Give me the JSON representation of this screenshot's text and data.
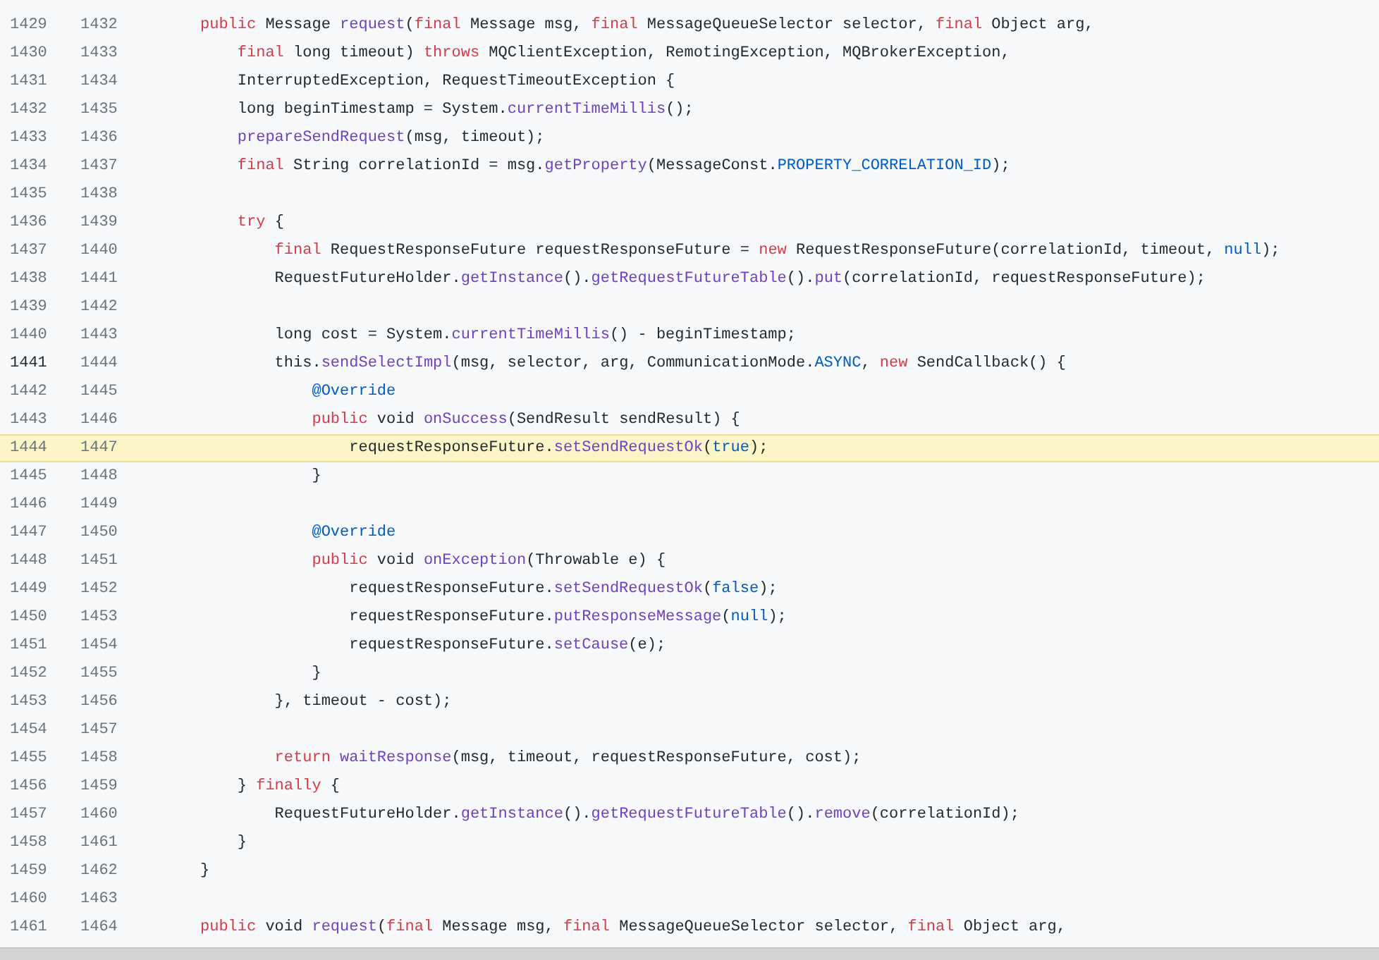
{
  "lines": [
    {
      "old": "1429",
      "new": "1432",
      "code": [
        {
          "kind": "keyword",
          "text": "public"
        },
        {
          "kind": "plain",
          "text": " Message "
        },
        {
          "kind": "function",
          "text": "request"
        },
        {
          "kind": "plain",
          "text": "("
        },
        {
          "kind": "keyword",
          "text": "final"
        },
        {
          "kind": "plain",
          "text": " Message msg, "
        },
        {
          "kind": "keyword",
          "text": "final"
        },
        {
          "kind": "plain",
          "text": " MessageQueueSelector selector, "
        },
        {
          "kind": "keyword",
          "text": "final"
        },
        {
          "kind": "plain",
          "text": " Object arg,"
        }
      ]
    },
    {
      "old": "1430",
      "new": "1433",
      "code": [
        {
          "kind": "keyword",
          "text": "    final"
        },
        {
          "kind": "plain",
          "text": " long timeout) "
        },
        {
          "kind": "keyword",
          "text": "throws"
        },
        {
          "kind": "plain",
          "text": " MQClientException, RemotingException, MQBrokerException,"
        }
      ]
    },
    {
      "old": "1431",
      "new": "1434",
      "code": [
        {
          "kind": "plain",
          "text": "    InterruptedException, RequestTimeoutException {"
        }
      ]
    },
    {
      "old": "1432",
      "new": "1435",
      "code": [
        {
          "kind": "plain",
          "text": "    long beginTimestamp = System."
        },
        {
          "kind": "function",
          "text": "currentTimeMillis"
        },
        {
          "kind": "plain",
          "text": "();"
        }
      ]
    },
    {
      "old": "1433",
      "new": "1436",
      "code": [
        {
          "kind": "function",
          "text": "    prepareSendRequest"
        },
        {
          "kind": "plain",
          "text": "(msg, timeout);"
        }
      ]
    },
    {
      "old": "1434",
      "new": "1437",
      "code": [
        {
          "kind": "keyword",
          "text": "    final"
        },
        {
          "kind": "plain",
          "text": " String correlationId = msg."
        },
        {
          "kind": "function",
          "text": "getProperty"
        },
        {
          "kind": "plain",
          "text": "(MessageConst."
        },
        {
          "kind": "constant",
          "text": "PROPERTY_CORRELATION_ID"
        },
        {
          "kind": "plain",
          "text": ");"
        }
      ]
    },
    {
      "old": "1435",
      "new": "1438"
    },
    {
      "old": "1436",
      "new": "1439",
      "code": [
        {
          "kind": "keyword",
          "text": "    try"
        },
        {
          "kind": "plain",
          "text": " {"
        }
      ]
    },
    {
      "old": "1437",
      "new": "1440",
      "code": [
        {
          "kind": "keyword",
          "text": "        final"
        },
        {
          "kind": "plain",
          "text": " RequestResponseFuture requestResponseFuture = "
        },
        {
          "kind": "keyword",
          "text": "new"
        },
        {
          "kind": "plain",
          "text": " RequestResponseFuture(correlationId, timeout, "
        },
        {
          "kind": "constant",
          "text": "null"
        },
        {
          "kind": "plain",
          "text": ");"
        }
      ]
    },
    {
      "old": "1438",
      "new": "1441",
      "code": [
        {
          "kind": "plain",
          "text": "        RequestFutureHolder."
        },
        {
          "kind": "function",
          "text": "getInstance"
        },
        {
          "kind": "plain",
          "text": "()."
        },
        {
          "kind": "function",
          "text": "getRequestFutureTable"
        },
        {
          "kind": "plain",
          "text": "()."
        },
        {
          "kind": "function",
          "text": "put"
        },
        {
          "kind": "plain",
          "text": "(correlationId, requestResponseFuture);"
        }
      ]
    },
    {
      "old": "1439",
      "new": "1442"
    },
    {
      "old": "1440",
      "new": "1443",
      "code": [
        {
          "kind": "plain",
          "text": "        long cost = System."
        },
        {
          "kind": "function",
          "text": "currentTimeMillis"
        },
        {
          "kind": "plain",
          "text": "() - beginTimestamp;"
        }
      ]
    },
    {
      "old": "1441",
      "new": "1444",
      "current": true,
      "code": [
        {
          "kind": "plain",
          "text": "        this."
        },
        {
          "kind": "function",
          "text": "sendSelectImpl"
        },
        {
          "kind": "plain",
          "text": "(msg, selector, arg, CommunicationMode."
        },
        {
          "kind": "constant",
          "text": "ASYNC"
        },
        {
          "kind": "plain",
          "text": ", "
        },
        {
          "kind": "keyword",
          "text": "new"
        },
        {
          "kind": "plain",
          "text": " SendCallback() {"
        }
      ]
    },
    {
      "old": "1442",
      "new": "1445",
      "code": [
        {
          "kind": "constant",
          "text": "            @Override"
        }
      ]
    },
    {
      "old": "1443",
      "new": "1446",
      "code": [
        {
          "kind": "keyword",
          "text": "            public"
        },
        {
          "kind": "plain",
          "text": " void "
        },
        {
          "kind": "function",
          "text": "onSuccess"
        },
        {
          "kind": "plain",
          "text": "(SendResult sendResult) {"
        }
      ]
    },
    {
      "old": "1444",
      "new": "1447",
      "highlighted": true,
      "code": [
        {
          "kind": "plain",
          "text": "                requestResponseFuture."
        },
        {
          "kind": "function",
          "text": "setSendRequestOk"
        },
        {
          "kind": "plain",
          "text": "("
        },
        {
          "kind": "constant",
          "text": "true"
        },
        {
          "kind": "plain",
          "text": ");"
        }
      ]
    },
    {
      "old": "1445",
      "new": "1448",
      "code": [
        {
          "kind": "plain",
          "text": "            }"
        }
      ]
    },
    {
      "old": "1446",
      "new": "1449"
    },
    {
      "old": "1447",
      "new": "1450",
      "code": [
        {
          "kind": "constant",
          "text": "            @Override"
        }
      ]
    },
    {
      "old": "1448",
      "new": "1451",
      "code": [
        {
          "kind": "keyword",
          "text": "            public"
        },
        {
          "kind": "plain",
          "text": " void "
        },
        {
          "kind": "function",
          "text": "onException"
        },
        {
          "kind": "plain",
          "text": "(Throwable e) {"
        }
      ]
    },
    {
      "old": "1449",
      "new": "1452",
      "code": [
        {
          "kind": "plain",
          "text": "                requestResponseFuture."
        },
        {
          "kind": "function",
          "text": "setSendRequestOk"
        },
        {
          "kind": "plain",
          "text": "("
        },
        {
          "kind": "constant",
          "text": "false"
        },
        {
          "kind": "plain",
          "text": ");"
        }
      ]
    },
    {
      "old": "1450",
      "new": "1453",
      "code": [
        {
          "kind": "plain",
          "text": "                requestResponseFuture."
        },
        {
          "kind": "function",
          "text": "putResponseMessage"
        },
        {
          "kind": "plain",
          "text": "("
        },
        {
          "kind": "constant",
          "text": "null"
        },
        {
          "kind": "plain",
          "text": ");"
        }
      ]
    },
    {
      "old": "1451",
      "new": "1454",
      "code": [
        {
          "kind": "plain",
          "text": "                requestResponseFuture."
        },
        {
          "kind": "function",
          "text": "setCause"
        },
        {
          "kind": "plain",
          "text": "(e);"
        }
      ]
    },
    {
      "old": "1452",
      "new": "1455",
      "code": [
        {
          "kind": "plain",
          "text": "            }"
        }
      ]
    },
    {
      "old": "1453",
      "new": "1456",
      "code": [
        {
          "kind": "plain",
          "text": "        }, timeout - cost);"
        }
      ]
    },
    {
      "old": "1454",
      "new": "1457"
    },
    {
      "old": "1455",
      "new": "1458",
      "code": [
        {
          "kind": "keyword",
          "text": "        return"
        },
        {
          "kind": "function",
          "text": " waitResponse"
        },
        {
          "kind": "plain",
          "text": "(msg, timeout, requestResponseFuture, cost);"
        }
      ]
    },
    {
      "old": "1456",
      "new": "1459",
      "code": [
        {
          "kind": "plain",
          "text": "    } "
        },
        {
          "kind": "keyword",
          "text": "finally"
        },
        {
          "kind": "plain",
          "text": " {"
        }
      ]
    },
    {
      "old": "1457",
      "new": "1460",
      "code": [
        {
          "kind": "plain",
          "text": "        RequestFutureHolder."
        },
        {
          "kind": "function",
          "text": "getInstance"
        },
        {
          "kind": "plain",
          "text": "()."
        },
        {
          "kind": "function",
          "text": "getRequestFutureTable"
        },
        {
          "kind": "plain",
          "text": "()."
        },
        {
          "kind": "function",
          "text": "remove"
        },
        {
          "kind": "plain",
          "text": "(correlationId);"
        }
      ]
    },
    {
      "old": "1458",
      "new": "1461",
      "code": [
        {
          "kind": "plain",
          "text": "    }"
        }
      ]
    },
    {
      "old": "1459",
      "new": "1462",
      "code": [
        {
          "kind": "plain",
          "text": "}"
        }
      ]
    },
    {
      "old": "1460",
      "new": "1463"
    },
    {
      "old": "1461",
      "new": "1464",
      "code": [
        {
          "kind": "keyword",
          "text": "public"
        },
        {
          "kind": "plain",
          "text": " void "
        },
        {
          "kind": "function",
          "text": "request"
        },
        {
          "kind": "plain",
          "text": "("
        },
        {
          "kind": "keyword",
          "text": "final"
        },
        {
          "kind": "plain",
          "text": " Message msg, "
        },
        {
          "kind": "keyword",
          "text": "final"
        },
        {
          "kind": "plain",
          "text": " MessageQueueSelector selector, "
        },
        {
          "kind": "keyword",
          "text": "final"
        },
        {
          "kind": "plain",
          "text": " Object arg,"
        }
      ]
    }
  ]
}
